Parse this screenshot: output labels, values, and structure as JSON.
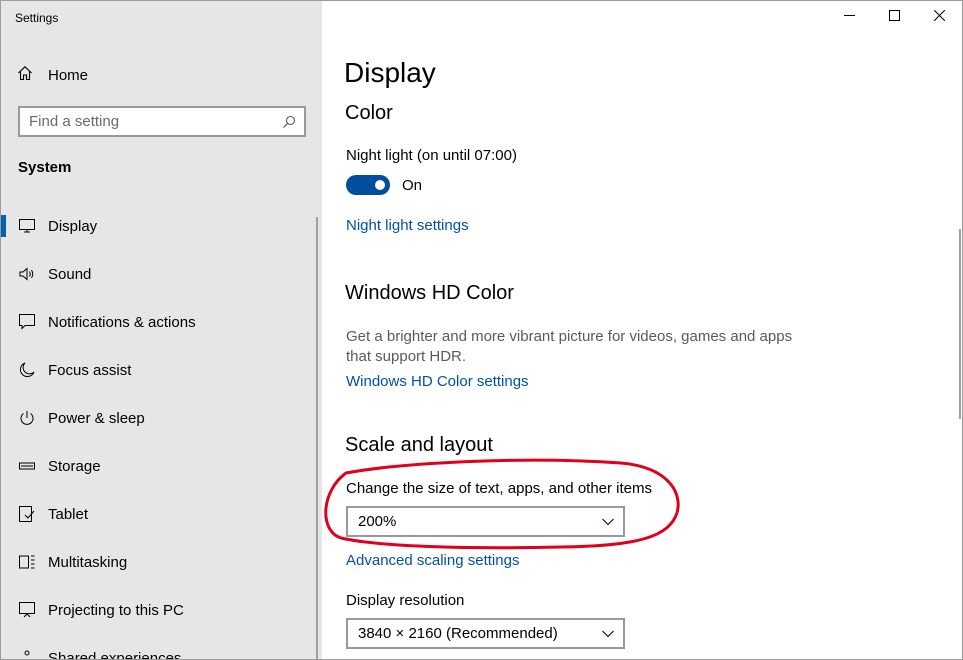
{
  "window": {
    "title": "Settings",
    "controls": [
      "minimize-icon",
      "maximize-icon",
      "close-icon"
    ]
  },
  "sidebar": {
    "home_label": "Home",
    "search_placeholder": "Find a setting",
    "section": "System",
    "items": [
      {
        "label": "Display",
        "icon": "monitor-icon",
        "selected": true
      },
      {
        "label": "Sound",
        "icon": "speaker-icon"
      },
      {
        "label": "Notifications & actions",
        "icon": "notification-icon"
      },
      {
        "label": "Focus assist",
        "icon": "moon-icon"
      },
      {
        "label": "Power & sleep",
        "icon": "power-icon"
      },
      {
        "label": "Storage",
        "icon": "storage-icon"
      },
      {
        "label": "Tablet",
        "icon": "tablet-icon"
      },
      {
        "label": "Multitasking",
        "icon": "multitasking-icon"
      },
      {
        "label": "Projecting to this PC",
        "icon": "projecting-icon"
      },
      {
        "label": "Shared experiences",
        "icon": "shared-experiences-icon"
      }
    ]
  },
  "content": {
    "page_title": "Display",
    "color": {
      "heading": "Color",
      "night_light_label": "Night light (on until 07:00)",
      "toggle_state": "On",
      "night_light_settings_link": "Night light settings"
    },
    "hd_color": {
      "heading": "Windows HD Color",
      "description": "Get a brighter and more vibrant picture for videos, games and apps that support HDR.",
      "settings_link": "Windows HD Color settings"
    },
    "scale": {
      "heading": "Scale and layout",
      "change_size_label": "Change the size of text, apps, and other items",
      "scale_value": "200%",
      "advanced_link": "Advanced scaling settings",
      "resolution_label": "Display resolution",
      "resolution_value": "3840 × 2160 (Recommended)"
    }
  },
  "colors": {
    "accent": "#0063b1",
    "toggle_on": "#004e9c",
    "link": "#0050a8",
    "sidebar_bg": "#e6e6e6",
    "annotation": "#e0001b"
  }
}
